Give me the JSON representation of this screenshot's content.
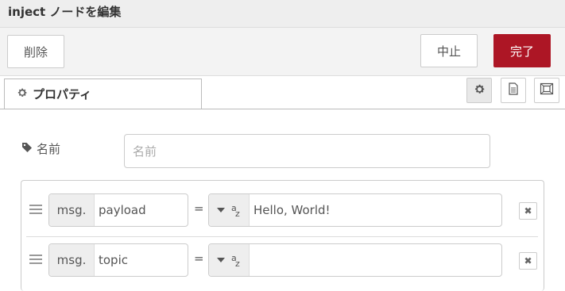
{
  "dialog": {
    "title": "inject ノードを編集"
  },
  "toolbar": {
    "delete_label": "削除",
    "cancel_label": "中止",
    "done_label": "完了",
    "done_color": "#ad1625"
  },
  "tabs": {
    "properties_label": "プロパティ",
    "icons": [
      "gear-icon",
      "document-icon",
      "appearance-icon"
    ]
  },
  "form": {
    "name_label": "名前",
    "name_placeholder": "名前",
    "name_value": ""
  },
  "props": [
    {
      "prefix": "msg.",
      "property": "payload",
      "equals": "=",
      "type_icon": "string-az-icon",
      "value": "Hello, World!"
    },
    {
      "prefix": "msg.",
      "property": "topic",
      "equals": "=",
      "type_icon": "string-az-icon",
      "value": ""
    }
  ]
}
